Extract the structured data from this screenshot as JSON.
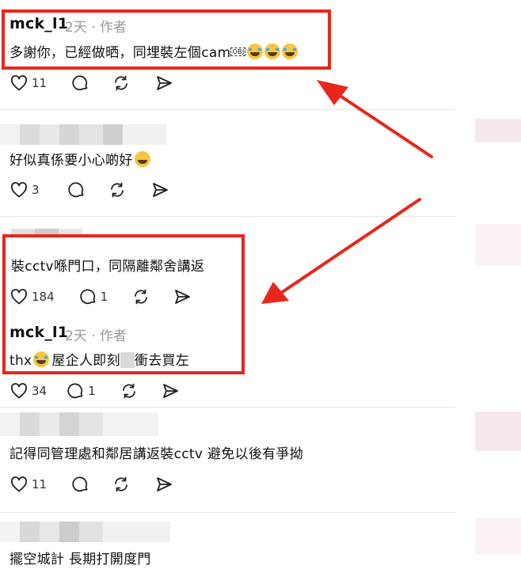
{
  "arrow_color": "#e8261c",
  "comments": [
    {
      "id": "c1",
      "author": "mck_l1",
      "time": "2天",
      "tag": "作者",
      "text": "多謝你，已經做晒，同埋裝左個cam",
      "obj_glyph": "OBJ",
      "emoji": [
        "crying-face",
        "crying-face",
        "crying-face"
      ],
      "likes": "11"
    },
    {
      "id": "c2",
      "text": "好似真係要小心啲好",
      "emoji": [
        "grinning-face"
      ],
      "likes": "3"
    },
    {
      "id": "c3",
      "text": "裝cctv喺門口，同隔離鄰舍講返",
      "likes": "184",
      "replies": "1"
    },
    {
      "id": "c4",
      "author": "mck_l1",
      "time": "2天",
      "tag": "作者",
      "text_a": "thx",
      "text_b": "屋企人即刻",
      "text_c": "衝去買左",
      "emoji": [
        "crying-face"
      ],
      "likes": "34",
      "replies": "1"
    },
    {
      "id": "c5",
      "text": "記得同管理處和鄰居講返裝cctv 避免以後有爭拗",
      "likes": "11"
    },
    {
      "id": "c6",
      "text": "擺空城計 長期打開度門"
    }
  ]
}
